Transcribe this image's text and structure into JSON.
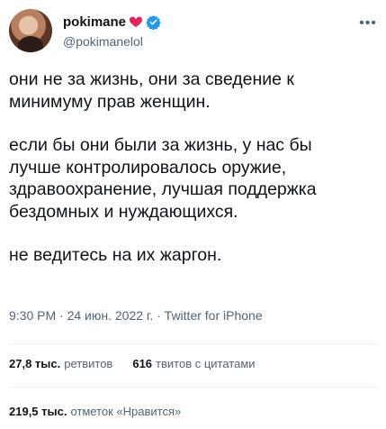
{
  "tweet": {
    "author": {
      "display_name": "pokimane",
      "handle": "@pokimanelol"
    },
    "paragraphs": [
      "они не за жизнь, они за сведение к\nминимуму прав женщин.",
      "если бы они были за жизнь, у нас бы\nлучше контролировалось оружие,\nздравоохранение, лучшая поддержка\nбездомных и нуждающихся.",
      "не ведитесь на их жаргон."
    ],
    "time": "9:30 PM",
    "date": "24 июн. 2022 г.",
    "separator": "·",
    "source": "Twitter for iPhone",
    "stats": {
      "retweets_count": "27,8 тыс.",
      "retweets_label": "ретвитов",
      "quotes_count": "616",
      "quotes_label": "твитов с цитатами",
      "likes_count": "219,5 тыс.",
      "likes_label": "отметок «Нравится»"
    },
    "colors": {
      "heart": "#e0245e",
      "verified": "#1d9bf0",
      "secondary_text": "#536471",
      "divider": "#eff3f4"
    }
  }
}
